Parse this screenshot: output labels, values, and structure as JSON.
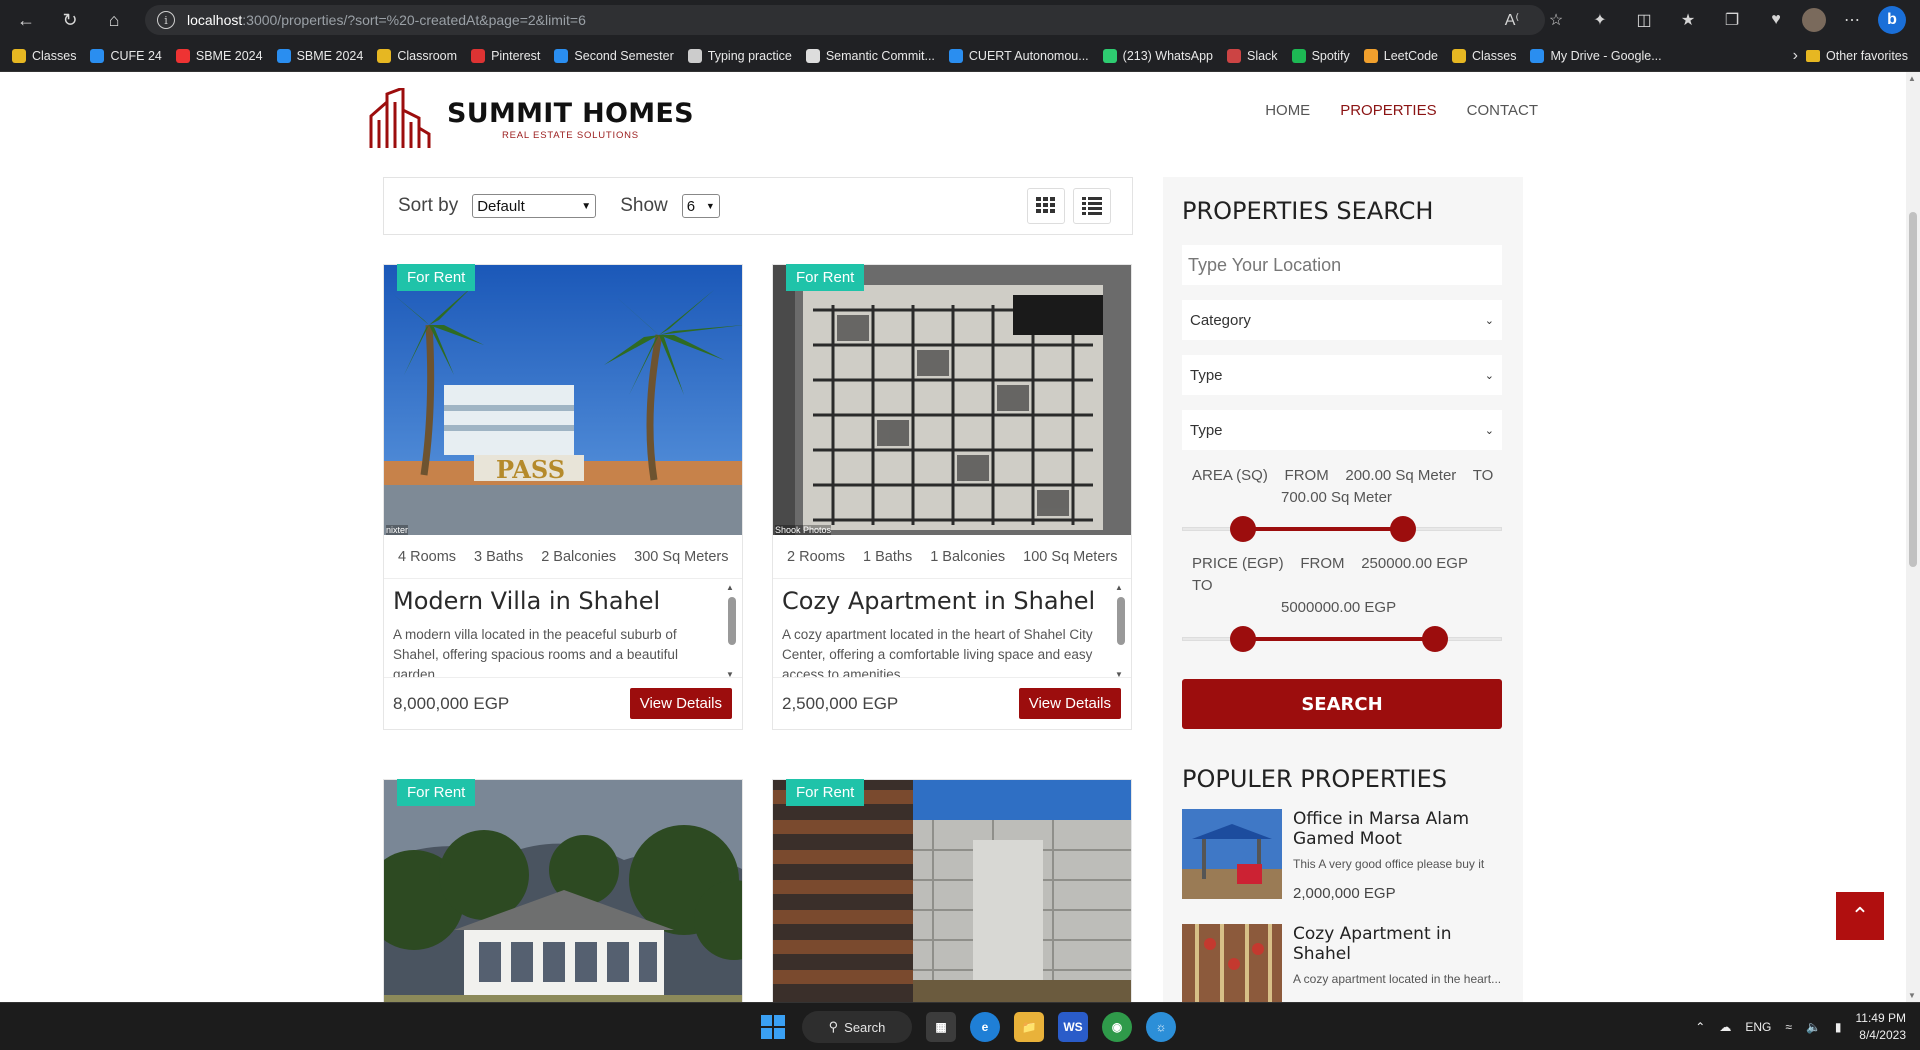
{
  "browser": {
    "url_host": "localhost",
    "url_rest": ":3000/properties/?sort=%20-createdAt&page=2&limit=6",
    "bookmarks": [
      "Classes",
      "CUFE 24",
      "SBME 2024",
      "SBME 2024",
      "Classroom",
      "Pinterest",
      "Second Semester",
      "Typing practice",
      "Semantic Commit...",
      "CUERT Autonomou...",
      "(213) WhatsApp",
      "Slack",
      "Spotify",
      "LeetCode",
      "Classes",
      "My Drive - Google..."
    ],
    "other_favorites": "Other favorites"
  },
  "site": {
    "brand": "SUMMIT HOMES",
    "tagline": "REAL ESTATE SOLUTIONS",
    "nav": [
      "HOME",
      "PROPERTIES",
      "CONTACT"
    ],
    "active_nav": "PROPERTIES"
  },
  "toolbar": {
    "sort_label": "Sort by",
    "sort_value": "Default",
    "show_label": "Show",
    "show_value": "6"
  },
  "listings": [
    {
      "badge": "For Rent",
      "credit": "nixter",
      "rooms": "4 Rooms",
      "baths": "3 Baths",
      "balconies": "2 Balconies",
      "area": "300 Sq Meters",
      "title": "Modern Villa in Shahel",
      "description": "A modern villa located in the peaceful suburb of Shahel, offering spacious rooms and a beautiful garden.",
      "price": "8,000,000 EGP",
      "button": "View Details"
    },
    {
      "badge": "For Rent",
      "credit": "Shook Photos",
      "rooms": "2 Rooms",
      "baths": "1 Baths",
      "balconies": "1 Balconies",
      "area": "100 Sq Meters",
      "title": "Cozy Apartment in Shahel",
      "description": "A cozy apartment located in the heart of Shahel City Center, offering a comfortable living space and easy access to amenities.",
      "price": "2,500,000 EGP",
      "button": "View Details"
    },
    {
      "badge": "For Rent"
    },
    {
      "badge": "For Rent"
    }
  ],
  "search": {
    "heading": "PROPERTIES SEARCH",
    "location_placeholder": "Type Your Location",
    "category": "Category",
    "type1": "Type",
    "type2": "Type",
    "area_label": "AREA (SQ)",
    "area_from_word": "FROM",
    "area_from": "200.00 Sq Meter",
    "area_to_word": "TO",
    "area_to": "700.00 Sq Meter",
    "price_label": "PRICE (EGP)",
    "price_from_word": "FROM",
    "price_from": "250000.00 EGP",
    "price_to_word": "TO",
    "price_to": "5000000.00 EGP",
    "button": "SEARCH",
    "area_range_fraction": [
      0.19,
      0.69
    ],
    "price_range_fraction": [
      0.19,
      0.79
    ]
  },
  "popular": {
    "heading": "POPULER PROPERTIES",
    "items": [
      {
        "title": "Office in Marsa Alam Gamed Moot",
        "description": "This A very good office please buy it",
        "price": "2,000,000 EGP"
      },
      {
        "title": "Cozy Apartment in Shahel",
        "description": "A cozy apartment located in the heart...",
        "price": ""
      }
    ]
  },
  "taskbar": {
    "search": "Search",
    "lang": "ENG",
    "time": "11:49 PM",
    "date": "8/4/2023"
  },
  "colors": {
    "accent": "#9c0d0d",
    "badge": "#1fc3a9"
  }
}
